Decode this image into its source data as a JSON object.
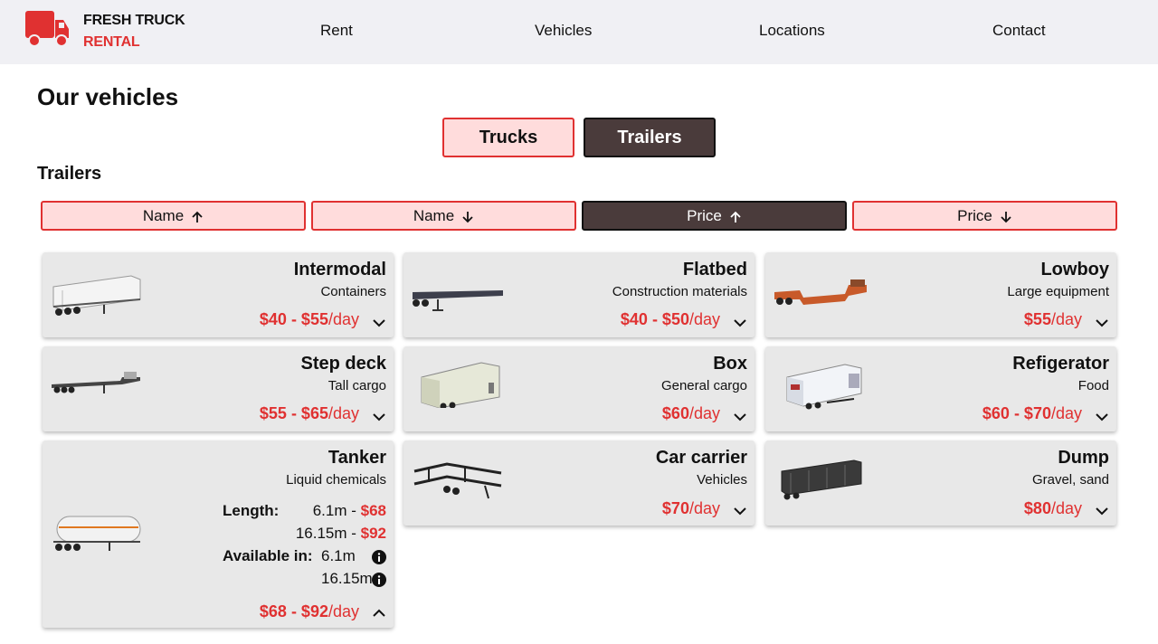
{
  "brand": {
    "line1": "FRESH TRUCK",
    "line2": "RENTAL",
    "accent": "#e03131"
  },
  "nav": {
    "rent": "Rent",
    "vehicles": "Vehicles",
    "locations": "Locations",
    "contact": "Contact"
  },
  "page": {
    "title": "Our vehicles",
    "section": "Trailers"
  },
  "type_toggle": {
    "trucks": "Trucks",
    "trailers": "Trailers",
    "selected": "Trailers"
  },
  "sort": {
    "name_asc": "Name",
    "name_desc": "Name",
    "price_asc": "Price",
    "price_desc": "Price",
    "selected": "price_asc"
  },
  "icons": {
    "logo": "truck-icon",
    "sort_up": "arrow-up-icon",
    "sort_down": "arrow-down-icon",
    "expand": "chevron-down-icon",
    "collapse": "chevron-up-icon",
    "info": "info-icon"
  },
  "vehicles": [
    {
      "name": "Intermodal",
      "cargo": "Containers",
      "price": "$40 - $55",
      "unit": "/day"
    },
    {
      "name": "Flatbed",
      "cargo": "Construction materials",
      "price": "$40 - $50",
      "unit": "/day"
    },
    {
      "name": "Lowboy",
      "cargo": "Large equipment",
      "price": "$55",
      "unit": "/day"
    },
    {
      "name": "Step deck",
      "cargo": "Tall cargo",
      "price": "$55 - $65",
      "unit": "/day"
    },
    {
      "name": "Box",
      "cargo": "General cargo",
      "price": "$60",
      "unit": "/day"
    },
    {
      "name": "Refigerator",
      "cargo": "Food",
      "price": "$60 - $70",
      "unit": "/day"
    },
    {
      "name": "Tanker",
      "cargo": "Liquid chemicals",
      "price": "$68 - $92",
      "unit": "/day",
      "details": {
        "length_label": "Length:",
        "lengths": [
          {
            "size": "6.1m - ",
            "price": "$68"
          },
          {
            "size": "16.15m - ",
            "price": "$92"
          }
        ],
        "available_label": "Available in:",
        "available": [
          "6.1m",
          "16.15m"
        ]
      }
    },
    {
      "name": "Car carrier",
      "cargo": "Vehicles",
      "price": "$70",
      "unit": "/day"
    },
    {
      "name": "Dump",
      "cargo": "Gravel, sand",
      "price": "$80",
      "unit": "/day"
    }
  ]
}
